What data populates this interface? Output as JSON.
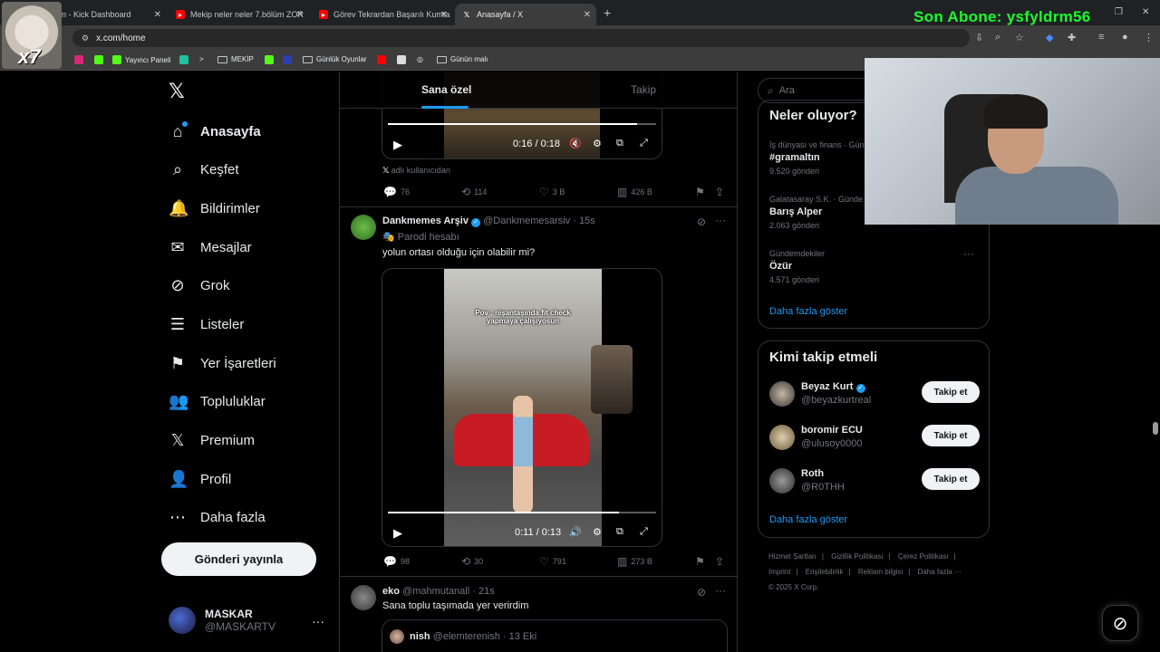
{
  "browser": {
    "tabs": [
      {
        "label": "n - Kick Dashboard",
        "favicon": "kick-icon"
      },
      {
        "label": "Mekip neler neler 7.bölüm ZOR",
        "favicon": "youtube-icon"
      },
      {
        "label": "Görev Tekrardan Başarılı Kumta",
        "favicon": "youtube-icon"
      },
      {
        "label": "Anasayfa / X",
        "favicon": "x-icon"
      }
    ],
    "overlay_text": "Son Abone: ysfyldrm56",
    "cat_overlay_text": "x7",
    "url": "x.com/home",
    "bookmarks": [
      {
        "label": "Yayıncı Paneli"
      },
      {
        "label": "MEKİP"
      },
      {
        "label": "Günlük Oyunlar"
      },
      {
        "label": "Günün malı"
      }
    ]
  },
  "nav": {
    "items": [
      {
        "label": "Anasayfa",
        "icon": "home-icon",
        "glyph": "⌂"
      },
      {
        "label": "Keşfet",
        "icon": "search-icon",
        "glyph": "⌕"
      },
      {
        "label": "Bildirimler",
        "icon": "bell-icon",
        "glyph": "🔔"
      },
      {
        "label": "Mesajlar",
        "icon": "mail-icon",
        "glyph": "✉"
      },
      {
        "label": "Grok",
        "icon": "grok-icon",
        "glyph": "⊘"
      },
      {
        "label": "Listeler",
        "icon": "list-icon",
        "glyph": "☰"
      },
      {
        "label": "Yer İşaretleri",
        "icon": "bookmark-icon",
        "glyph": "⚑"
      },
      {
        "label": "Topluluklar",
        "icon": "people-icon",
        "glyph": "👥"
      },
      {
        "label": "Premium",
        "icon": "x-icon",
        "glyph": "𝕏"
      },
      {
        "label": "Profil",
        "icon": "person-icon",
        "glyph": "👤"
      },
      {
        "label": "Daha fazla",
        "icon": "more-circle-icon",
        "glyph": "⋯"
      }
    ],
    "post_button": "Gönderi yayınla",
    "account": {
      "name": "MASKAR",
      "handle": "@MASKARTV"
    }
  },
  "timeline": {
    "tabs": [
      "Sana özel",
      "Takip"
    ],
    "post1": {
      "video_time": "0:16 / 0:18",
      "progress": 0.93,
      "source_text": "adlı kullanıcıdan",
      "replies": "76",
      "reposts": "114",
      "likes": "3 B",
      "views": "426 B"
    },
    "post2": {
      "name": "Dankmemes Arşiv",
      "handle": "@Dankmemesarsiv",
      "time": "15s",
      "badge": "Parodi hesabı",
      "text": "yolun ortası olduğu için olabilir mi?",
      "video_caption": "Pov : nişantaşında fit check yapmaya çalışıyosun",
      "video_time": "0:11 / 0:13",
      "progress": 0.86,
      "replies": "98",
      "reposts": "30",
      "likes": "791",
      "views": "273 B"
    },
    "post3": {
      "name": "eko",
      "handle": "@mahmutanall",
      "time": "21s",
      "text": "Sana toplu taşımada yer verirdim",
      "quote_name": "nish",
      "quote_handle": "@elemterenish",
      "quote_time": "13 Eki"
    }
  },
  "sidebar": {
    "search_placeholder": "Ara",
    "trends_title": "Neler oluyor?",
    "trends": [
      {
        "category": "İş dünyası ve finans · Gün",
        "name": "#gramaltın",
        "count": "9.520 gönderi"
      },
      {
        "category": "Galatasaray S.K. · Günde",
        "name": "Barış Alper",
        "count": "2.063 gönderi"
      },
      {
        "category": "Gündemdekiler",
        "name": "Özür",
        "count": "4.571 gönderi"
      }
    ],
    "trends_more": "Daha fazla göster",
    "who_title": "Kimi takip etmeli",
    "who": [
      {
        "name": "Beyaz Kurt",
        "handle": "@beyazkurtreal",
        "verified": true,
        "button": "Takip et"
      },
      {
        "name": "boromir ECU",
        "handle": "@ulusoy0000",
        "verified": false,
        "button": "Takip et"
      },
      {
        "name": "Roth",
        "handle": "@R0THH",
        "verified": false,
        "button": "Takip et"
      }
    ],
    "who_more": "Daha fazla göster",
    "footer": [
      "Hizmet Şartları",
      "Gizlilik Politikası",
      "Çerez Politikası",
      "Imprint",
      "Erişilebilirlik",
      "Reklam bilgisi",
      "Daha fazla ···",
      "© 2025 X Corp."
    ]
  }
}
